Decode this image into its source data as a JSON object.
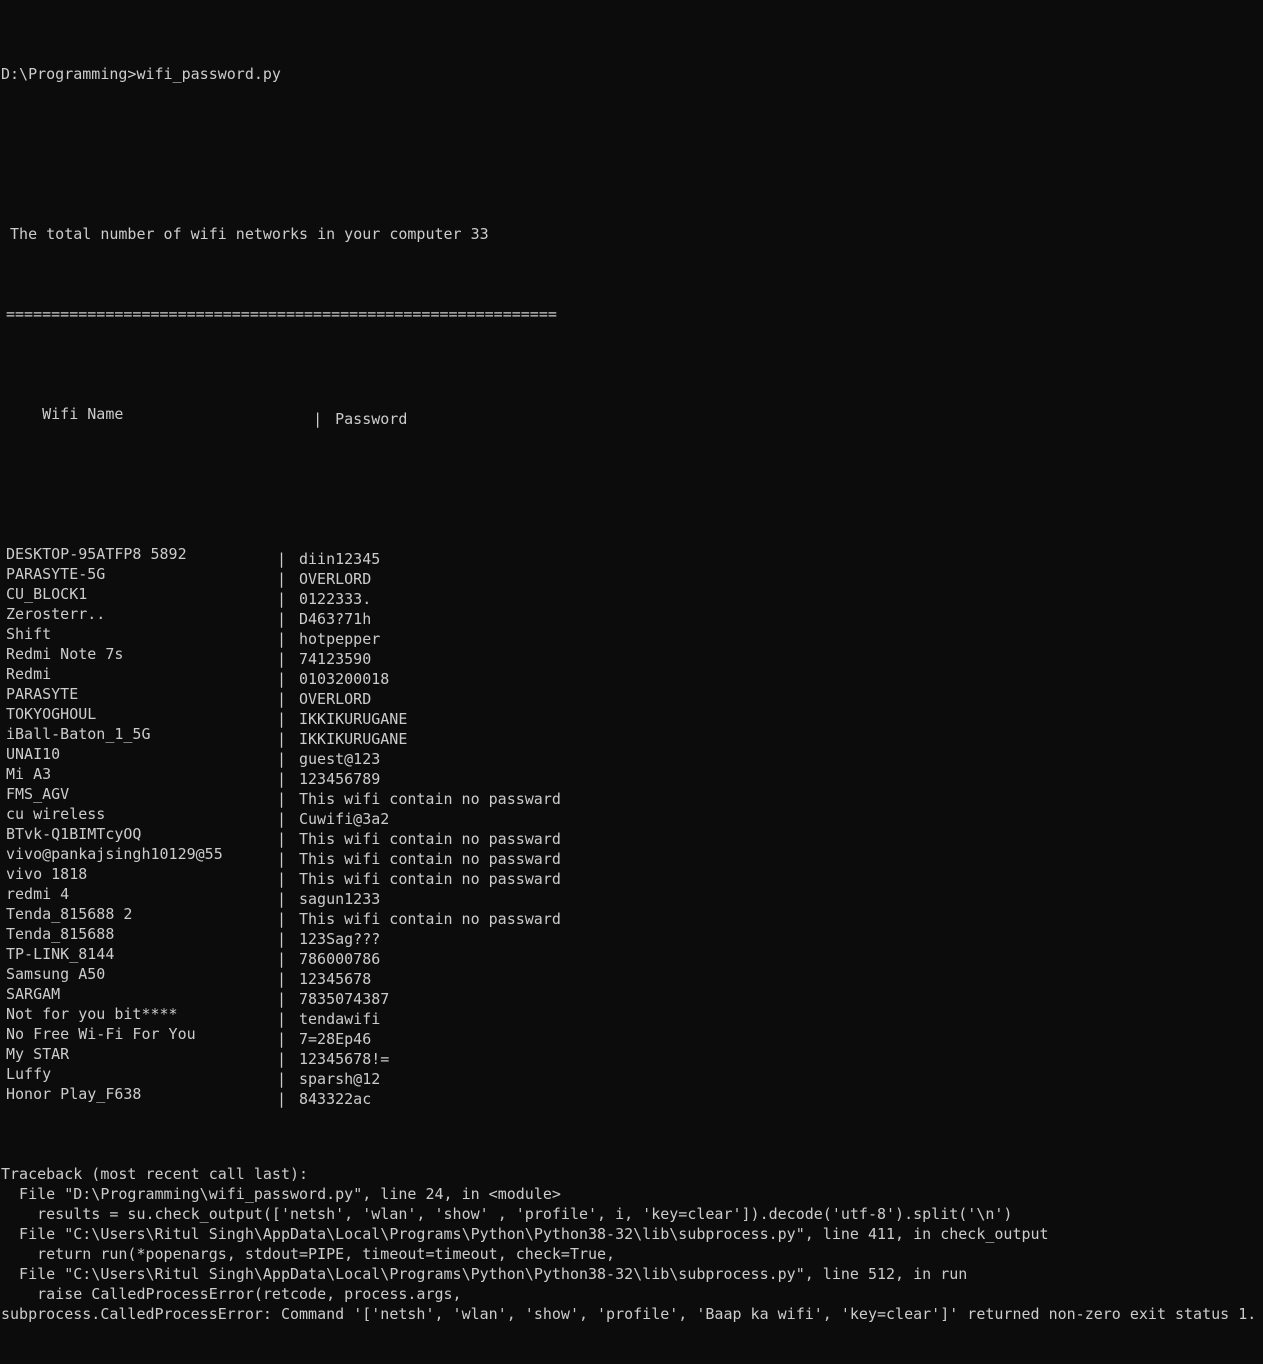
{
  "terminal": {
    "colors": {
      "background": "#0c0c0c",
      "foreground": "#cccccc"
    },
    "prompt_line": "D:\\Programming>wifi_password.py",
    "blank": "",
    "summary_line": " The total number of wifi networks in your computer 33",
    "separator": "=============================================================",
    "header": {
      "name": "Wifi Name",
      "divider": "|",
      "password": "Password"
    },
    "columns": [
      "Wifi Name",
      "Password"
    ],
    "no_password_text": "This wifi contain no passward",
    "rows": [
      {
        "name": "DESKTOP-95ATFP8 5892",
        "sep": "|",
        "password": "diin12345"
      },
      {
        "name": "PARASYTE-5G",
        "sep": "|",
        "password": "OVERLORD"
      },
      {
        "name": "CU_BLOCK1",
        "sep": "|",
        "password": "0122333."
      },
      {
        "name": "Zerosterr..",
        "sep": "|",
        "password": "D463?71h"
      },
      {
        "name": "Shift",
        "sep": "|",
        "password": "hotpepper"
      },
      {
        "name": "Redmi Note 7s",
        "sep": "|",
        "password": "74123590"
      },
      {
        "name": "Redmi",
        "sep": "|",
        "password": "0103200018"
      },
      {
        "name": "PARASYTE",
        "sep": "|",
        "password": "OVERLORD"
      },
      {
        "name": "TOKYOGHOUL",
        "sep": "|",
        "password": "IKKIKURUGANE"
      },
      {
        "name": "iBall-Baton_1_5G",
        "sep": "|",
        "password": "IKKIKURUGANE"
      },
      {
        "name": "UNAI10",
        "sep": "|",
        "password": "guest@123"
      },
      {
        "name": "Mi A3",
        "sep": "|",
        "password": "123456789"
      },
      {
        "name": "FMS_AGV",
        "sep": "|",
        "password": "This wifi contain no passward"
      },
      {
        "name": "cu wireless",
        "sep": "|",
        "password": "Cuwifi@3a2"
      },
      {
        "name": "BTvk-Q1BIMTcyOQ",
        "sep": "|",
        "password": "This wifi contain no passward"
      },
      {
        "name": "vivo@pankajsingh10129@55",
        "sep": "|",
        "password": "This wifi contain no passward"
      },
      {
        "name": "vivo 1818",
        "sep": "|",
        "password": "This wifi contain no passward"
      },
      {
        "name": "redmi 4",
        "sep": "|",
        "password": "sagun1233"
      },
      {
        "name": "Tenda_815688 2",
        "sep": "|",
        "password": "This wifi contain no passward"
      },
      {
        "name": "Tenda_815688",
        "sep": "|",
        "password": "123Sag???"
      },
      {
        "name": "TP-LINK_8144",
        "sep": "|",
        "password": "786000786"
      },
      {
        "name": "Samsung A50",
        "sep": "|",
        "password": "12345678"
      },
      {
        "name": "SARGAM",
        "sep": "|",
        "password": "7835074387"
      },
      {
        "name": "Not for you bit****",
        "sep": "|",
        "password": "tendawifi"
      },
      {
        "name": "No Free Wi-Fi For You",
        "sep": "|",
        "password": "7=28Ep46"
      },
      {
        "name": "My STAR",
        "sep": "|",
        "password": "12345678!="
      },
      {
        "name": "Luffy",
        "sep": "|",
        "password": "sparsh@12"
      },
      {
        "name": "Honor Play_F638",
        "sep": "|",
        "password": "843322ac"
      }
    ],
    "traceback": {
      "lines": [
        "Traceback (most recent call last):",
        "  File \"D:\\Programming\\wifi_password.py\", line 24, in <module>",
        "    results = su.check_output(['netsh', 'wlan', 'show' , 'profile', i, 'key=clear']).decode('utf-8').split('\\n')",
        "  File \"C:\\Users\\Ritul Singh\\AppData\\Local\\Programs\\Python\\Python38-32\\lib\\subprocess.py\", line 411, in check_output",
        "    return run(*popenargs, stdout=PIPE, timeout=timeout, check=True,",
        "  File \"C:\\Users\\Ritul Singh\\AppData\\Local\\Programs\\Python\\Python38-32\\lib\\subprocess.py\", line 512, in run",
        "    raise CalledProcessError(retcode, process.args,",
        "subprocess.CalledProcessError: Command '['netsh', 'wlan', 'show', 'profile', 'Baap ka wifi', 'key=clear']' returned non-zero exit status 1."
      ]
    }
  }
}
